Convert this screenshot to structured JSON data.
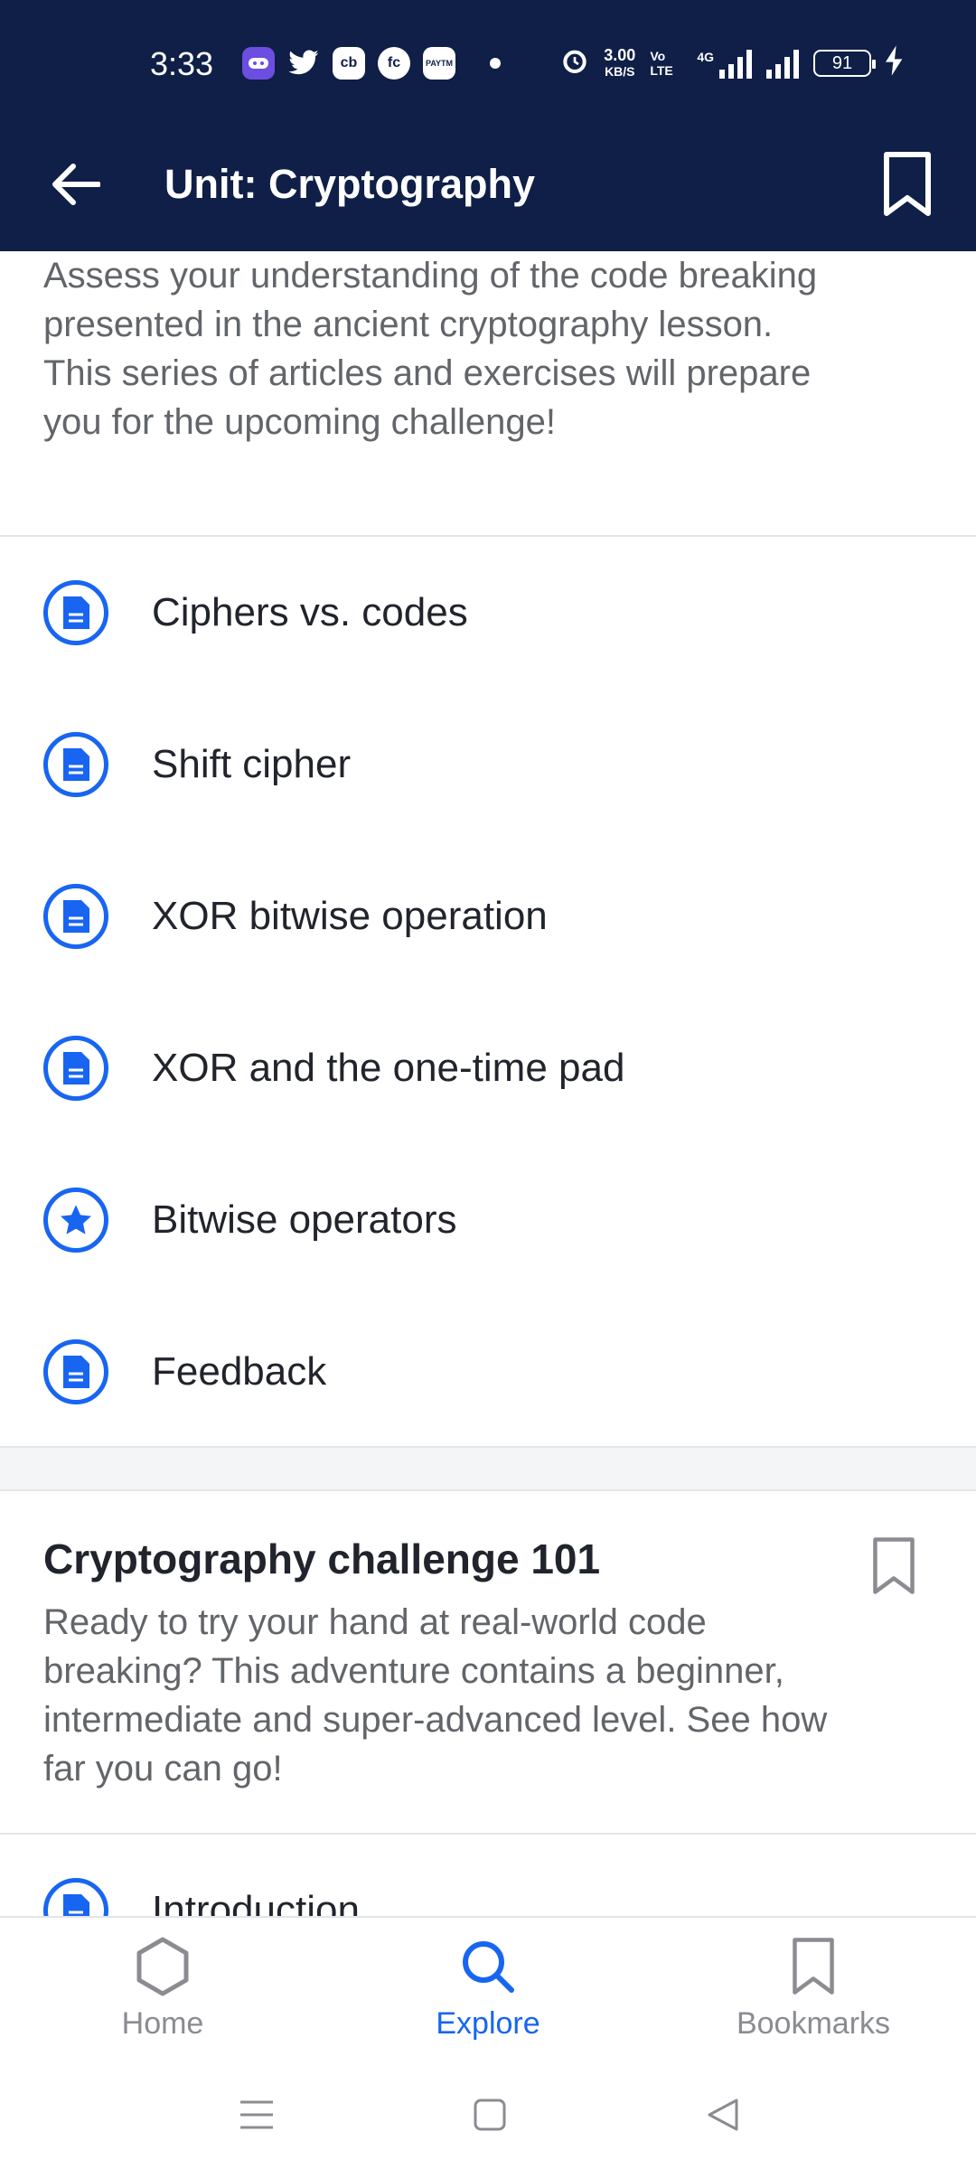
{
  "status_bar": {
    "time": "3:33",
    "apps": [
      "game-icon",
      "twitter-icon",
      "cb-icon",
      "fc-icon",
      "paytm-icon"
    ],
    "app_labels": [
      "cb",
      "fc",
      "PAYTM"
    ],
    "net_speed_top": "3.00",
    "net_speed_bottom": "KB/S",
    "volte": "Vo LTE",
    "network": "4G",
    "battery": "91"
  },
  "app_bar": {
    "title": "Unit: Cryptography"
  },
  "intro": {
    "description": "Assess your understanding of the code breaking presented in the ancient cryptography lesson. This series of articles and exercises will prepare you for the upcoming challenge!"
  },
  "items": [
    {
      "label": "Ciphers vs. codes",
      "icon": "article-icon"
    },
    {
      "label": "Shift cipher",
      "icon": "article-icon"
    },
    {
      "label": "XOR bitwise operation",
      "icon": "article-icon"
    },
    {
      "label": "XOR and the one-time pad",
      "icon": "article-icon"
    },
    {
      "label": "Bitwise operators",
      "icon": "star-icon"
    },
    {
      "label": "Feedback",
      "icon": "article-icon"
    }
  ],
  "section": {
    "title": "Cryptography challenge 101",
    "description": "Ready to try your hand at real-world code breaking? This adventure contains a beginner, intermediate and super-advanced level. See how far you can go!",
    "first_item": "Introduction"
  },
  "bottom_nav": {
    "home": "Home",
    "explore": "Explore",
    "bookmarks": "Bookmarks",
    "active": "Explore"
  },
  "colors": {
    "header_bg": "#0f1f47",
    "accent": "#1865f2",
    "text": "#21242c",
    "muted": "#626569"
  }
}
